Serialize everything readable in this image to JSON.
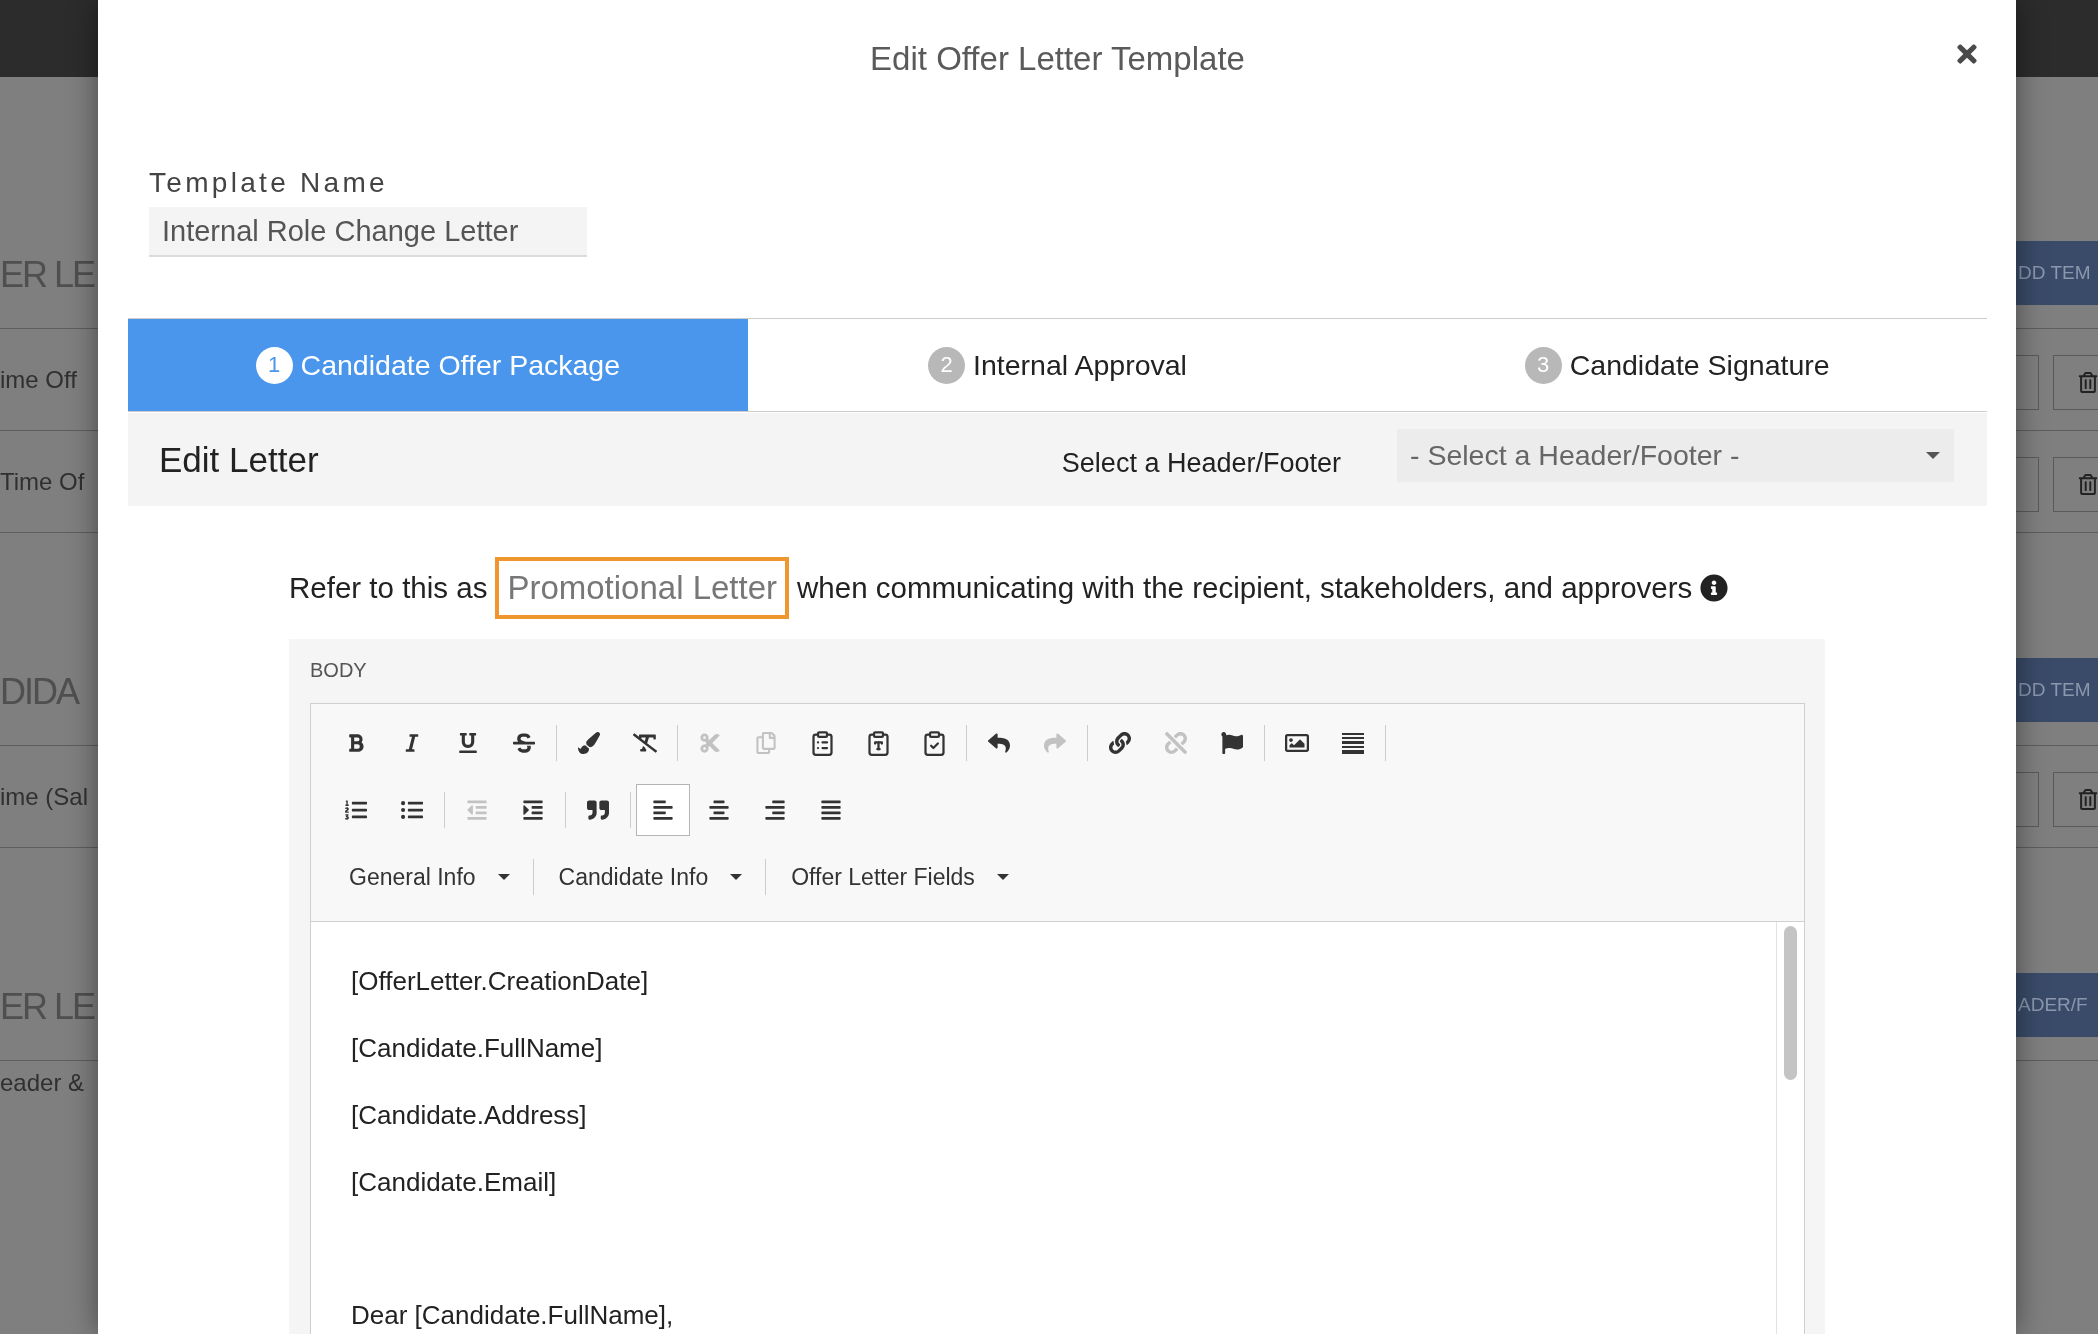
{
  "background_page": {
    "sections": [
      {
        "heading": "ER LE",
        "button": "DD TEM",
        "rows": [
          {
            "kind": "item",
            "text": "ime Off"
          },
          {
            "kind": "item",
            "text": "Time Of"
          }
        ]
      },
      {
        "heading": "DIDA",
        "button": "DD TEM",
        "rows": [
          {
            "kind": "item",
            "text": "ime (Sal"
          }
        ]
      },
      {
        "heading": "ER LE",
        "button": "ADER/F",
        "rows": [
          {
            "kind": "header",
            "text": "eader &"
          }
        ]
      }
    ]
  },
  "modal": {
    "title": "Edit Offer Letter Template",
    "template_name": {
      "label": "Template Name",
      "value": "Internal Role Change Letter"
    },
    "steps": [
      {
        "number": "1",
        "label": "Candidate Offer Package",
        "selected": true
      },
      {
        "number": "2",
        "label": "Internal Approval",
        "selected": false
      },
      {
        "number": "3",
        "label": "Candidate Signature",
        "selected": false
      }
    ],
    "edit_bar": {
      "title": "Edit Letter",
      "select_label": "Select a Header/Footer",
      "select_value": "- Select a Header/Footer -"
    },
    "refer": {
      "before": "Refer to this as",
      "value": "Promotional Letter",
      "after": "when communicating with the recipient, stakeholders, and approvers"
    },
    "body": {
      "label": "BODY",
      "toolbar_rows": [
        [
          [
            {
              "kind": "bold",
              "disabled": false,
              "active": false
            },
            {
              "kind": "italic",
              "disabled": false,
              "active": false
            },
            {
              "kind": "underline",
              "disabled": false,
              "active": false
            },
            {
              "kind": "strike",
              "disabled": false,
              "active": false
            }
          ],
          [
            {
              "kind": "brush",
              "disabled": false,
              "active": false
            },
            {
              "kind": "clear",
              "disabled": false,
              "active": false
            }
          ],
          [
            {
              "kind": "cut",
              "disabled": true,
              "active": false
            },
            {
              "kind": "copy",
              "disabled": true,
              "active": false
            },
            {
              "kind": "paste",
              "disabled": false,
              "active": false
            },
            {
              "kind": "pastetext",
              "disabled": false,
              "active": false
            },
            {
              "kind": "pasteword",
              "disabled": false,
              "active": false
            }
          ],
          [
            {
              "kind": "undo",
              "disabled": false,
              "active": false
            },
            {
              "kind": "redo",
              "disabled": true,
              "active": false
            }
          ],
          [
            {
              "kind": "link",
              "disabled": false,
              "active": false
            },
            {
              "kind": "unlink",
              "disabled": true,
              "active": false
            },
            {
              "kind": "anchor",
              "disabled": false,
              "active": false
            }
          ],
          [
            {
              "kind": "image",
              "disabled": false,
              "active": false
            },
            {
              "kind": "rule",
              "disabled": false,
              "active": false
            }
          ]
        ],
        [
          [
            {
              "kind": "numbered",
              "disabled": false,
              "active": false
            },
            {
              "kind": "bulleted",
              "disabled": false,
              "active": false
            }
          ],
          [
            {
              "kind": "outdent",
              "disabled": true,
              "active": false
            },
            {
              "kind": "indent",
              "disabled": false,
              "active": false
            }
          ],
          [
            {
              "kind": "blockquote",
              "disabled": false,
              "active": false
            }
          ],
          [
            {
              "kind": "alignleft",
              "disabled": false,
              "active": true
            },
            {
              "kind": "aligncenter",
              "disabled": false,
              "active": false
            },
            {
              "kind": "alignright",
              "disabled": false,
              "active": false
            },
            {
              "kind": "justify",
              "disabled": false,
              "active": false
            }
          ]
        ]
      ],
      "field_menus": [
        "General Info",
        "Candidate Info",
        "Offer Letter Fields"
      ],
      "merge_fields": [
        "[OfferLetter.CreationDate]",
        "[Candidate.FullName]",
        "[Candidate.Address]",
        "[Candidate.Email]"
      ],
      "salutation": "Dear [Candidate.FullName],"
    }
  }
}
